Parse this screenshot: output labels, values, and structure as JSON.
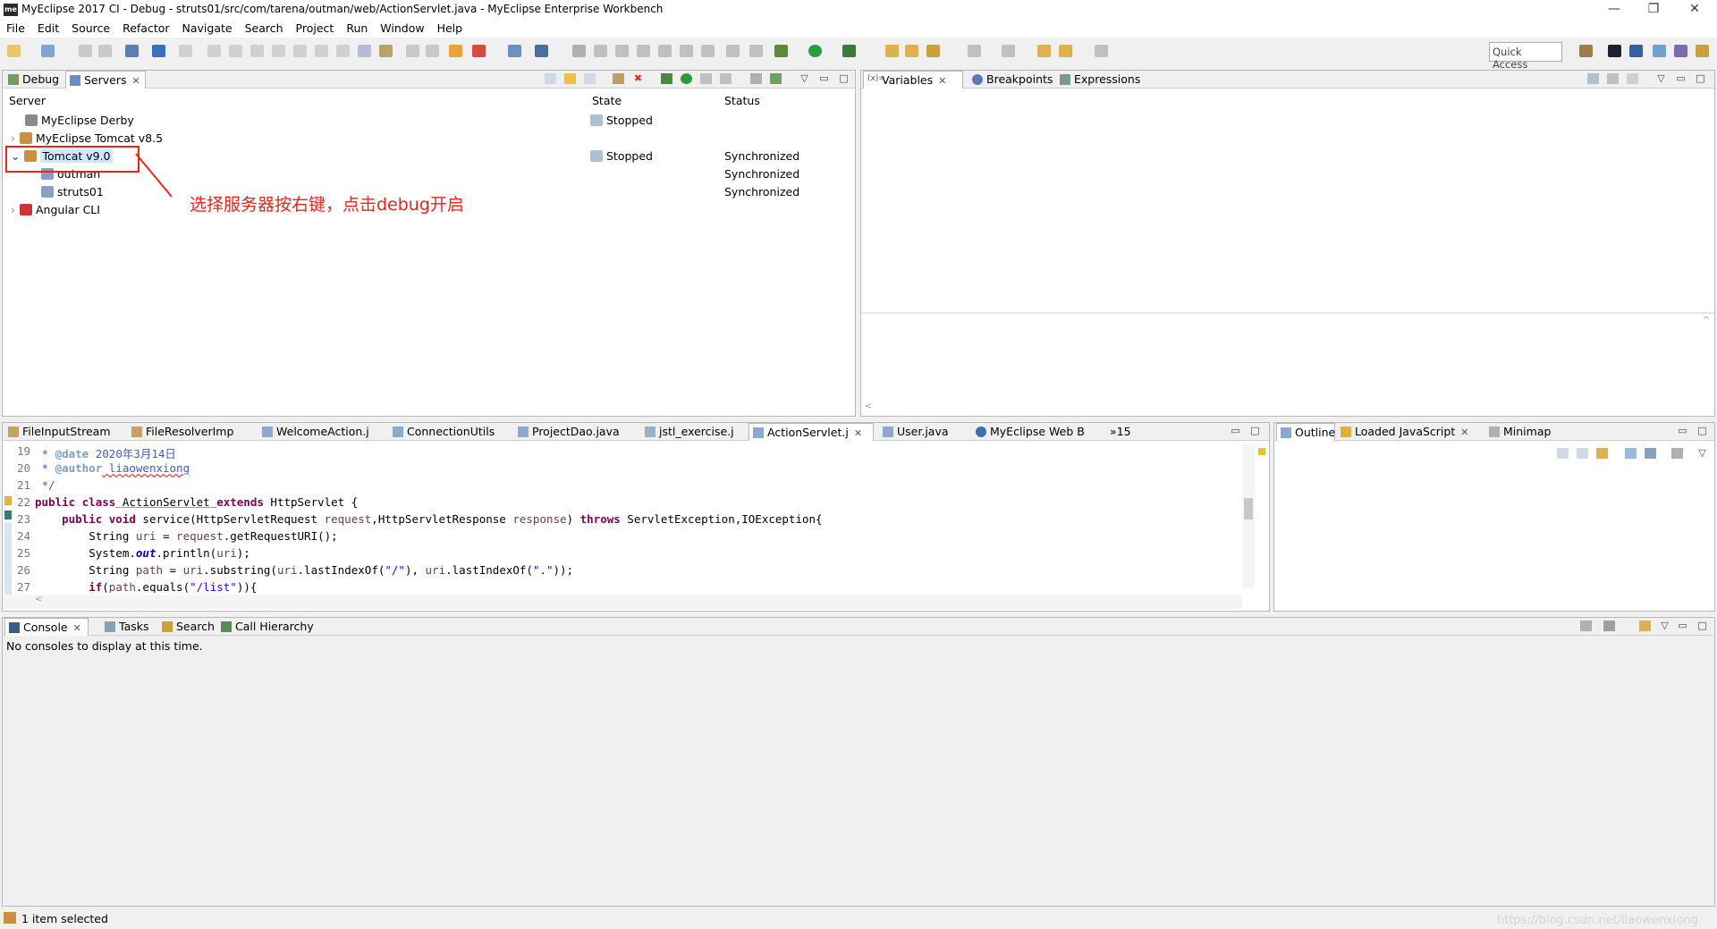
{
  "window": {
    "title": "MyEclipse 2017 CI - Debug - struts01/src/com/tarena/outman/web/ActionServlet.java - MyEclipse Enterprise Workbench",
    "logo": "me",
    "minimize": "—",
    "maximize": "❐",
    "close": "✕"
  },
  "menu": [
    "File",
    "Edit",
    "Source",
    "Refactor",
    "Navigate",
    "Search",
    "Project",
    "Run",
    "Window",
    "Help"
  ],
  "quick_access": "Quick Access",
  "top_left_tabs": [
    {
      "label": "Debug"
    },
    {
      "label": "Servers",
      "close": "✕"
    }
  ],
  "servers": {
    "col_server": "Server",
    "col_state": "State",
    "col_status": "Status",
    "rows": [
      {
        "name": "MyEclipse Derby",
        "state": "Stopped",
        "status": ""
      },
      {
        "name": "MyEclipse Tomcat v8.5",
        "state": "",
        "status": ""
      },
      {
        "name": "Tomcat v9.0",
        "state": "Stopped",
        "status": "Synchronized"
      },
      {
        "name": "outman",
        "state": "",
        "status": "Synchronized"
      },
      {
        "name": "struts01",
        "state": "",
        "status": "Synchronized"
      },
      {
        "name": "Angular CLI",
        "state": "",
        "status": ""
      }
    ],
    "annotation": "选择服务器按右键，点击debug开启"
  },
  "top_right_tabs": [
    {
      "label": "Variables",
      "close": "✕"
    },
    {
      "label": "Breakpoints"
    },
    {
      "label": "Expressions"
    }
  ],
  "editor_tabs": [
    {
      "label": "FileInputStream"
    },
    {
      "label": "FileResolverImp"
    },
    {
      "label": "WelcomeAction.j"
    },
    {
      "label": "ConnectionUtils"
    },
    {
      "label": "ProjectDao.java"
    },
    {
      "label": "jstl_exercise.j"
    },
    {
      "label": "ActionServlet.j",
      "close": "✕"
    },
    {
      "label": "User.java"
    },
    {
      "label": "MyEclipse Web B"
    },
    {
      "label": "»15"
    }
  ],
  "code": {
    "line_numbers": [
      "19",
      "20",
      "21",
      "22",
      "23",
      "24",
      "25",
      "26",
      "27"
    ],
    "l19_a": " * ",
    "l19_b": "@date",
    "l19_c": " 2020年3月14日",
    "l20_a": " * ",
    "l20_b": "@author",
    "l20_c": " liaowenxiong",
    "l21": " */",
    "l22_kw": "public class",
    "l22_a": " ActionServlet ",
    "l22_kw2": "extends",
    "l22_b": " HttpServlet {",
    "l23_kw": "    public void",
    "l23_a": " service(HttpServletRequest ",
    "l23_p1": "request",
    "l23_b": ",HttpServletResponse ",
    "l23_p2": "response",
    "l23_c": ") ",
    "l23_kw2": "throws",
    "l23_d": " ServletException,IOException{",
    "l24_a": "        String ",
    "l24_p": "uri",
    "l24_b": " = ",
    "l24_p2": "request",
    "l24_c": ".getRequestURI();",
    "l25_a": "        System.",
    "l25_f": "out",
    "l25_b": ".println(",
    "l25_p": "uri",
    "l25_c": ");",
    "l26_a": "        String ",
    "l26_p": "path",
    "l26_b": " = ",
    "l26_p2": "uri",
    "l26_c": ".substring(",
    "l26_p3": "uri",
    "l26_d": ".lastIndexOf(",
    "l26_s1": "\"/\"",
    "l26_e": "), ",
    "l26_p4": "uri",
    "l26_f": ".lastIndexOf(",
    "l26_s2": "\".\"",
    "l26_g": "));",
    "l27_kw": "        if",
    "l27_a": "(",
    "l27_p": "path",
    "l27_b": ".equals(",
    "l27_s": "\"/list\"",
    "l27_c": ")){"
  },
  "outline_tabs": [
    {
      "label": "Outline"
    },
    {
      "label": "Loaded JavaScript",
      "close": "✕"
    },
    {
      "label": "Minimap"
    }
  ],
  "bottom_tabs": [
    {
      "label": "Console",
      "close": "✕"
    },
    {
      "label": "Tasks"
    },
    {
      "label": "Search"
    },
    {
      "label": "Call Hierarchy"
    }
  ],
  "console_message": "No consoles to display at this time.",
  "status_bar": "1 item selected",
  "watermark": "https://blog.csdn.net/liaowenxiong",
  "colors": {
    "annotation_red": "#e8261c",
    "selection": "#cde8ff"
  }
}
